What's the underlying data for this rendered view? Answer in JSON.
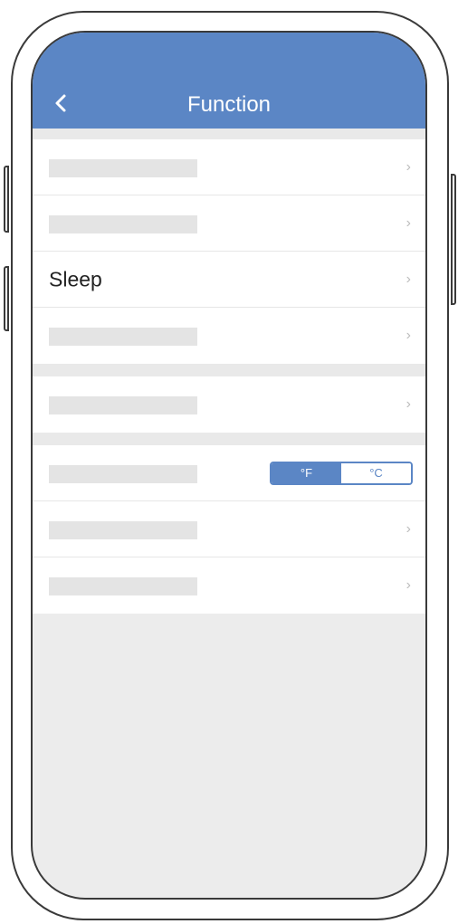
{
  "header": {
    "title": "Function",
    "back_icon": "chevron-left-icon",
    "color": "#5b86c5"
  },
  "rows": {
    "sleep_label": "Sleep",
    "chevron": "›"
  },
  "unit_toggle": {
    "fahrenheit": "°F",
    "celsius": "°C",
    "selected": "°F"
  }
}
